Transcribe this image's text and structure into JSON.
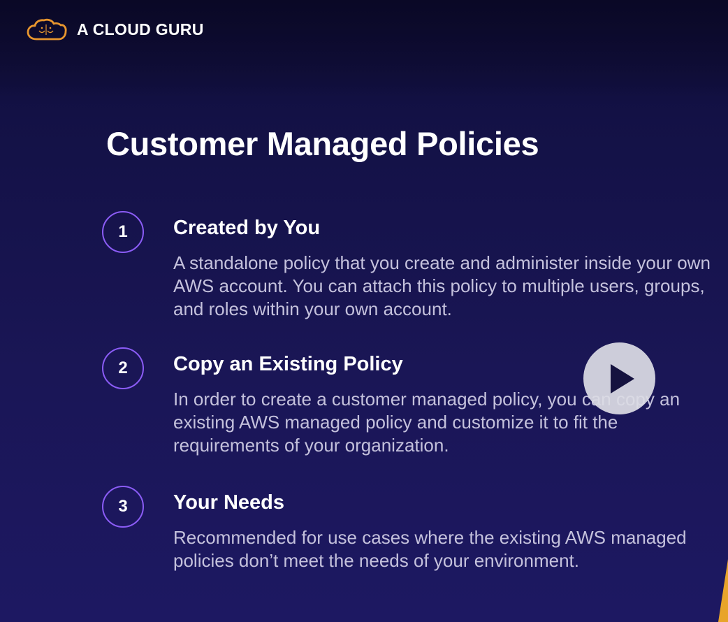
{
  "brand": {
    "name": "A CLOUD GURU",
    "logo_icon": "cloud-logo-icon",
    "accent_color": "#e8962e"
  },
  "slide": {
    "title": "Customer Managed Policies",
    "items": [
      {
        "number": "1",
        "heading": "Created by You",
        "body": "A standalone policy that you create and administer inside your own AWS account. You can attach this policy to multiple users, groups, and roles within your own account."
      },
      {
        "number": "2",
        "heading": "Copy an Existing Policy",
        "body": "In order to create a customer managed policy, you can copy an existing AWS managed policy and customize it to fit the requirements of your organization."
      },
      {
        "number": "3",
        "heading": "Your Needs",
        "body": "Recommended for use cases where the existing AWS managed policies don’t meet the needs of your environment."
      }
    ]
  },
  "player": {
    "play_icon": "play-icon"
  },
  "colors": {
    "background": "#1a1656",
    "circle_border": "#8b5cf6",
    "body_text": "#c4c1dc",
    "wedge": "#e8a42a"
  }
}
